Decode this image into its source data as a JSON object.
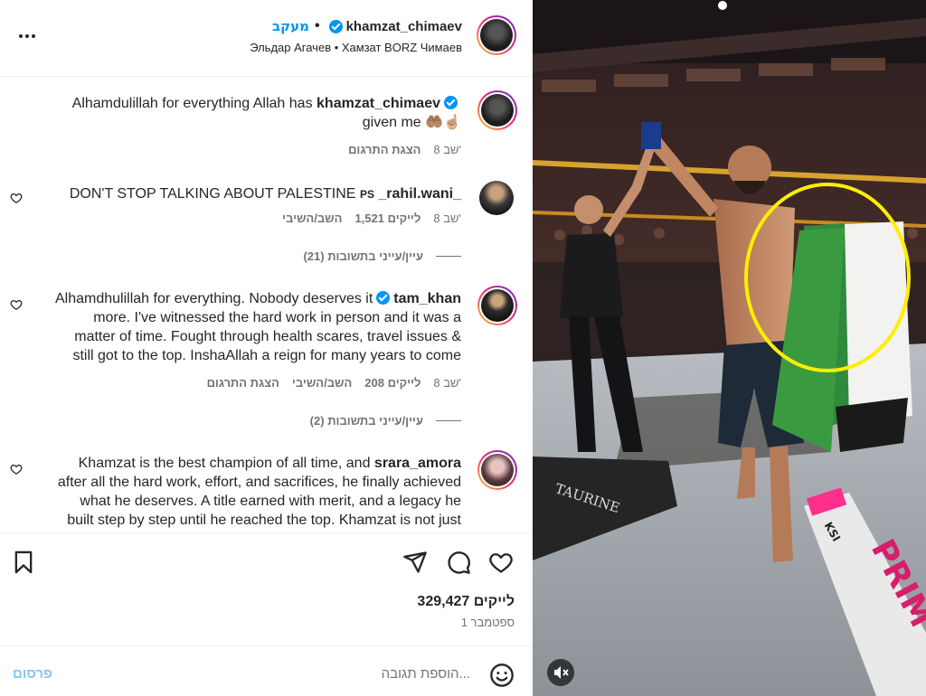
{
  "header": {
    "username": "khamzat_chimaev",
    "follow_label": "מעקב",
    "separator": "•",
    "subtitle": "Эльдар Агачев • Хамзат BORZ Чимаев",
    "more_icon": "more-icon"
  },
  "caption": {
    "author": "khamzat_chimaev",
    "text_line1": "Alhamdulillah for everything Allah has",
    "text_line2": "given me 🤲🏽☝🏼",
    "time": "8 שב'",
    "translate": "הצגת התרגום"
  },
  "comments": [
    {
      "author": "_rahil.wani_",
      "badge": "PS",
      "text": "DON'T STOP TALKING ABOUT PALESTINE",
      "time": "8 שב'",
      "likes": "1,521 לייקים",
      "reply": "השב/השיבי",
      "view_replies": "עיין/עייני בתשובות (21)"
    },
    {
      "author": "tam_khan",
      "text_line1": "Alhamdhulillah for everything. Nobody deserves it",
      "text_line2": "more. I've witnessed the hard work in person and it was a",
      "text_line3": "matter of time. Fought through health scares, travel issues &",
      "text_line4": "still got to the top. InshaAllah a reign for many years to come",
      "time": "8 שב'",
      "likes": "208 לייקים",
      "reply": "השב/השיבי",
      "translate": "הצגת התרגום",
      "view_replies": "עיין/עייני בתשובות (2)"
    },
    {
      "author": "srara_amora",
      "text_line1": "Khamzat is the best champion of all time, and",
      "text_line2": "after all the hard work, effort, and sacrifices, he finally achieved",
      "text_line3": "what he deserves. A title earned with merit, and a legacy he",
      "text_line4": "built step by step until he reached the top. Khamzat is not just"
    }
  ],
  "actions": {
    "likes_count": "329,427 לייקים",
    "date": "1 ספטמבר"
  },
  "add_comment": {
    "placeholder": "הוספת תגובה...",
    "post_label": "פרסום"
  },
  "media": {
    "banner_text": "TAURINE",
    "bottle_text": "PRIM",
    "bottle_small": "KSI",
    "highlight_color": "#ffee00"
  },
  "colors": {
    "link_blue": "#0095f6",
    "post_blue_disabled": "#82c6f9",
    "secondary_text": "#737373"
  }
}
